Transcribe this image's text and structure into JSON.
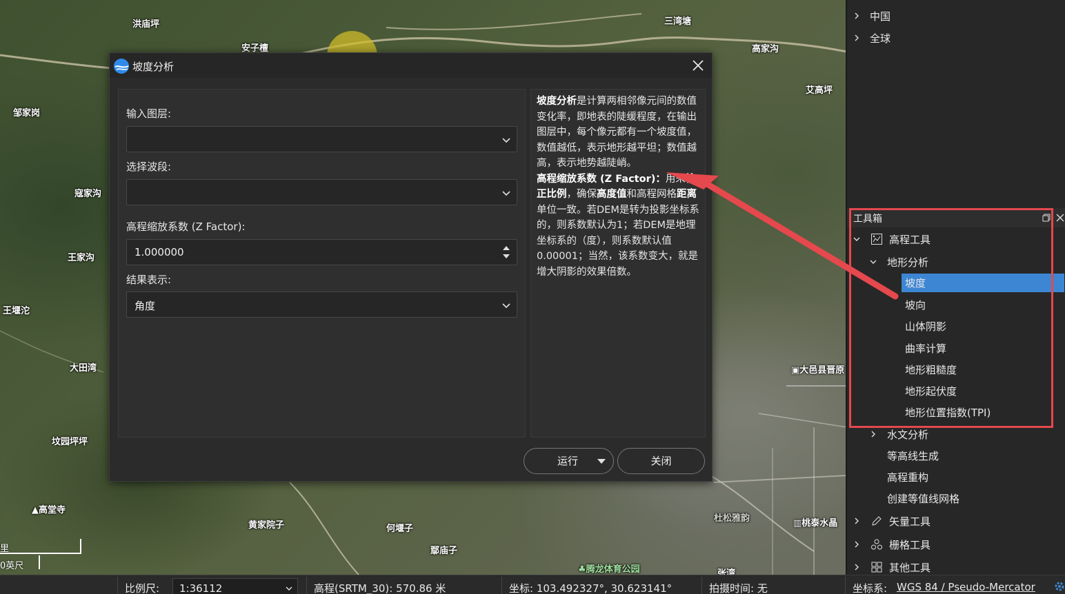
{
  "map": {
    "places": [
      {
        "name": "洪庙坪"
      },
      {
        "name": "安子檀"
      },
      {
        "name": "三湾塘"
      },
      {
        "name": "高家沟"
      },
      {
        "name": "邹家岗"
      },
      {
        "name": "艾高坪"
      },
      {
        "name": "寇家沟"
      },
      {
        "name": "王家沟"
      },
      {
        "name": "王堰沱"
      },
      {
        "name": "大田湾"
      },
      {
        "name": "坟园坪坪"
      },
      {
        "name": "高堂寺"
      },
      {
        "name": "黄家院子"
      },
      {
        "name": "何堰子"
      },
      {
        "name": "鄢庙子"
      },
      {
        "name": "大邑县晋原"
      },
      {
        "name": "桃泰水晶"
      },
      {
        "name": "腾龙体育公园"
      },
      {
        "name": "杜松雅韵"
      },
      {
        "name": "张湾"
      }
    ],
    "scale_bar": {
      "top_label": "里",
      "bottom_label": "0英尺"
    }
  },
  "dialog": {
    "title": "坡度分析",
    "fields": {
      "input_layer_label": "输入图层:",
      "input_layer_value": "",
      "band_label": "选择波段:",
      "band_value": "",
      "zfactor_label": "高程缩放系数 (Z Factor):",
      "zfactor_value": "1.000000",
      "result_label": "结果表示:",
      "result_value": "角度"
    },
    "help": {
      "p1_bold": "坡度分析",
      "p1_text": "是计算两相邻像元间的数值变化率，即地表的陡缓程度，在输出图层中，每个像元都有一个坡度值，数值越低，表示地形越平坦；数值越高，表示地势越陡峭。",
      "p2_bold1": "高程缩放系数 (Z Factor)：",
      "p2_text1": "用来",
      "p2_bold2": "校正比例",
      "p2_text2": "，确保",
      "p2_bold3": "高度值",
      "p2_text3": "和高程网格",
      "p2_bold4": "距离",
      "p2_text4": "单位一致。若DEM是转为投影坐标系的，则系数默认为1；若DEM是地理坐标系的（度），则系数默认值0.00001；当然，该系数变大，就是增大阴影的效果倍数。"
    },
    "buttons": {
      "run": "运行",
      "close": "关闭"
    }
  },
  "layers_tree": {
    "items": [
      {
        "label": "中国"
      },
      {
        "label": "全球"
      }
    ]
  },
  "toolbox": {
    "title": "工具箱",
    "elevation_tools": "高程工具",
    "terrain_analysis": "地形分析",
    "terrain_items": [
      {
        "label": "坡度"
      },
      {
        "label": "坡向"
      },
      {
        "label": "山体阴影"
      },
      {
        "label": "曲率计算"
      },
      {
        "label": "地形粗糙度"
      },
      {
        "label": "地形起伏度"
      },
      {
        "label": "地形位置指数(TPI)"
      }
    ],
    "hydro": "水文分析",
    "contour_gen": "等高线生成",
    "elev_rebuild": "高程重构",
    "contour_grid": "创建等值线网格",
    "vector_tools": "矢量工具",
    "raster_tools": "栅格工具",
    "other_tools": "其他工具"
  },
  "status_bar": {
    "scale_label": "比例尺:",
    "scale_value": "1:36112",
    "elevation": "高程(SRTM_30):  570.86 米",
    "coords": "坐标:  103.492327°, 30.623141°",
    "capture_time": "拍摄时间:  无",
    "crs_label": "坐标系:",
    "crs_value": "WGS 84 / Pseudo-Mercator"
  },
  "colors": {
    "selection": "#3d86d4",
    "highlight_box": "#e5484d",
    "annotation_arrow": "#e5484d",
    "cursor_marker": "#d2be28"
  }
}
